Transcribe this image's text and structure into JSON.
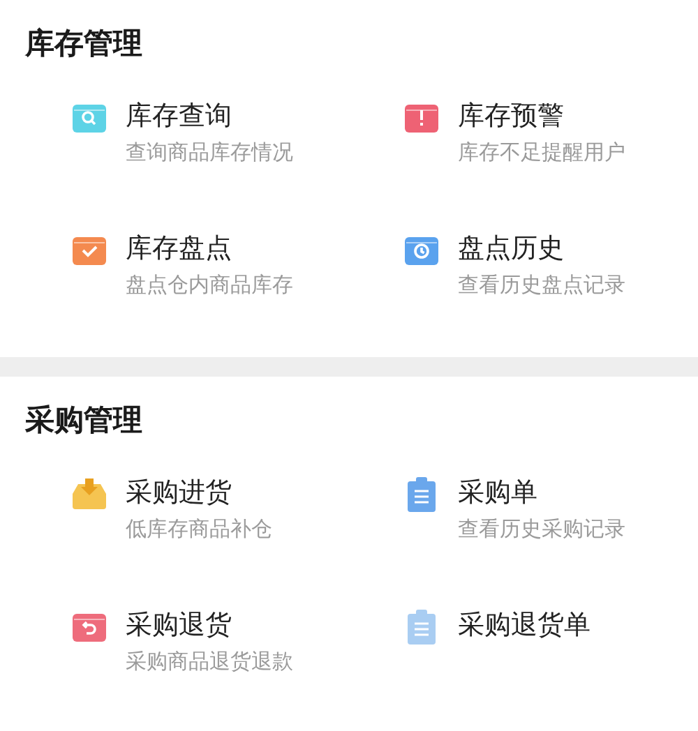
{
  "sections": [
    {
      "title": "库存管理",
      "items": [
        {
          "title": "库存查询",
          "subtitle": "查询商品库存情况",
          "kind": "search",
          "color": "#5dd3e6"
        },
        {
          "title": "库存预警",
          "subtitle": "库存不足提醒用户",
          "kind": "alert",
          "color": "#ee6274"
        },
        {
          "title": "库存盘点",
          "subtitle": "盘点仓内商品库存",
          "kind": "check",
          "color": "#f48a4f"
        },
        {
          "title": "盘点历史",
          "subtitle": "查看历史盘点记录",
          "kind": "clock",
          "color": "#5aa2ee"
        }
      ]
    },
    {
      "title": "采购管理",
      "items": [
        {
          "title": "采购进货",
          "subtitle": "低库存商品补仓",
          "kind": "inbox",
          "color": "#f5c451"
        },
        {
          "title": "采购单",
          "subtitle": "查看历史采购记录",
          "kind": "clipboard",
          "color": "#6aa7ec"
        },
        {
          "title": "采购退货",
          "subtitle": "采购商品退货退款",
          "kind": "undo",
          "color": "#ee6c7c"
        },
        {
          "title": "采购退货单",
          "kind": "clipboard",
          "color": "#a9cdf2"
        }
      ]
    }
  ]
}
